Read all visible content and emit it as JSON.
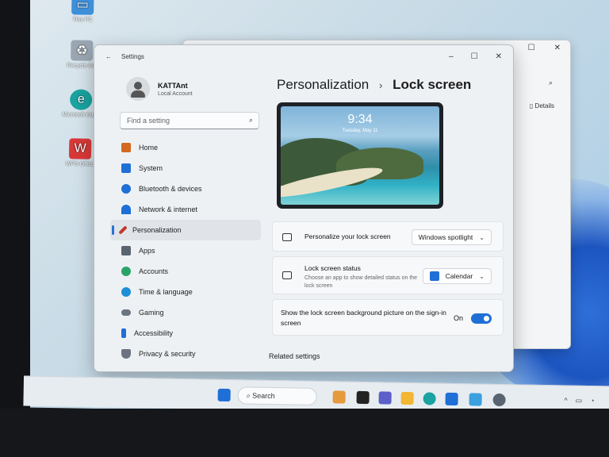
{
  "desktop": {
    "icons": [
      {
        "label": "This PC",
        "icon": "monitor-icon"
      },
      {
        "label": "Recycle Bin",
        "icon": "recycle-bin-icon"
      },
      {
        "label": "Microsoft Edge",
        "icon": "edge-icon"
      },
      {
        "label": "WPS Office",
        "icon": "wps-office-icon"
      }
    ]
  },
  "background_window": {
    "details_label": "Details"
  },
  "settings": {
    "title": "Settings",
    "back_glyph": "←",
    "window_controls": {
      "minimize": "–",
      "maximize": "☐",
      "close": "✕"
    },
    "user": {
      "name": "KATTAnt",
      "account_type": "Local Account"
    },
    "search": {
      "placeholder": "Find a setting"
    },
    "nav": [
      {
        "label": "Home",
        "icon": "home-icon",
        "color": "#d2691e"
      },
      {
        "label": "System",
        "icon": "system-icon",
        "color": "#1f6fd6"
      },
      {
        "label": "Bluetooth & devices",
        "icon": "bluetooth-icon",
        "color": "#1f6fd6"
      },
      {
        "label": "Network & internet",
        "icon": "wifi-icon",
        "color": "#1f6fd6"
      },
      {
        "label": "Personalization",
        "icon": "brush-icon",
        "color": "#c0392b",
        "active": true
      },
      {
        "label": "Apps",
        "icon": "apps-icon",
        "color": "#5a6470"
      },
      {
        "label": "Accounts",
        "icon": "accounts-icon",
        "color": "#2aa36b"
      },
      {
        "label": "Time & language",
        "icon": "globe-icon",
        "color": "#1f8fd6"
      },
      {
        "label": "Gaming",
        "icon": "gamepad-icon",
        "color": "#6b7480"
      },
      {
        "label": "Accessibility",
        "icon": "accessibility-icon",
        "color": "#1f6fd6"
      },
      {
        "label": "Privacy & security",
        "icon": "shield-icon",
        "color": "#6b7480"
      }
    ],
    "breadcrumb": {
      "parent": "Personalization",
      "separator": "›",
      "current": "Lock screen"
    },
    "preview": {
      "time": "9:34",
      "date": "Tuesday, May 11"
    },
    "cards": {
      "personalize": {
        "title": "Personalize your lock screen",
        "value": "Windows spotlight"
      },
      "status": {
        "title": "Lock screen status",
        "description": "Choose an app to show detailed status on the lock screen",
        "value": "Calendar"
      },
      "signin": {
        "title": "Show the lock screen background picture on the sign-in screen",
        "state": "On",
        "enabled": true
      }
    },
    "related_settings_label": "Related settings"
  },
  "taskbar": {
    "search_label": "Search",
    "accent": "#1f6fd6"
  }
}
